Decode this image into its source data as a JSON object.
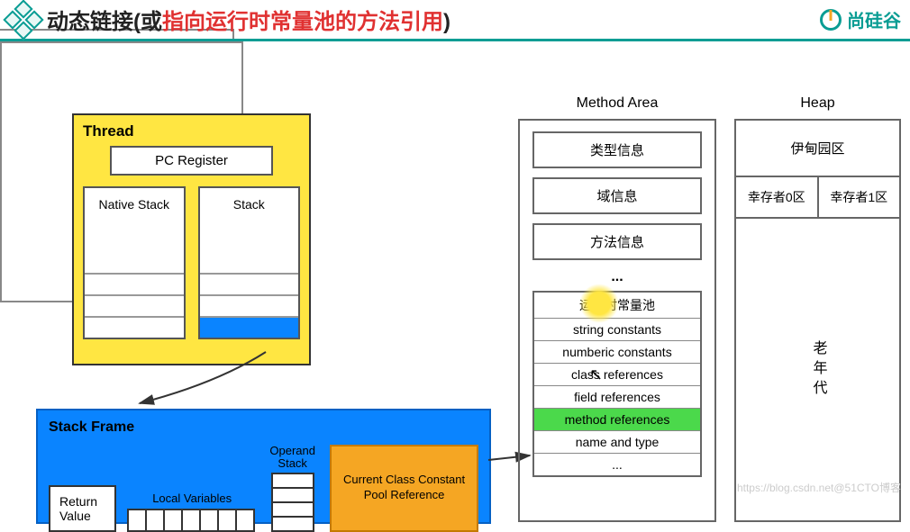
{
  "header": {
    "title_black": "动态链接(或",
    "title_red": "指向运行时常量池的方法引用",
    "title_black2": ")",
    "brand": "尚硅谷"
  },
  "thread": {
    "label": "Thread",
    "pc_register": "PC Register",
    "native_stack": "Native Stack",
    "stack": "Stack"
  },
  "stack_frame": {
    "title": "Stack Frame",
    "return_value": "Return Value",
    "local_variables": "Local Variables",
    "operand_stack": "Operand Stack",
    "constant_pool_ref": "Current Class Constant Pool Reference"
  },
  "method_area": {
    "title": "Method Area",
    "type_info": "类型信息",
    "field_info": "域信息",
    "method_info": "方法信息",
    "dots": "...",
    "pool": {
      "runtime_pool": "运行时常量池",
      "string_constants": "string constants",
      "numeric_constants": "numberic constants",
      "class_references": "class references",
      "field_references": "field references",
      "method_references": "method references",
      "name_and_type": "name and type",
      "dots": "..."
    }
  },
  "heap": {
    "title": "Heap",
    "eden": "伊甸园区",
    "survivor0": "幸存者0区",
    "survivor1": "幸存者1区",
    "old_gen": "老年代"
  },
  "watermark": "https://blog.csdn.net@51CTO博客"
}
